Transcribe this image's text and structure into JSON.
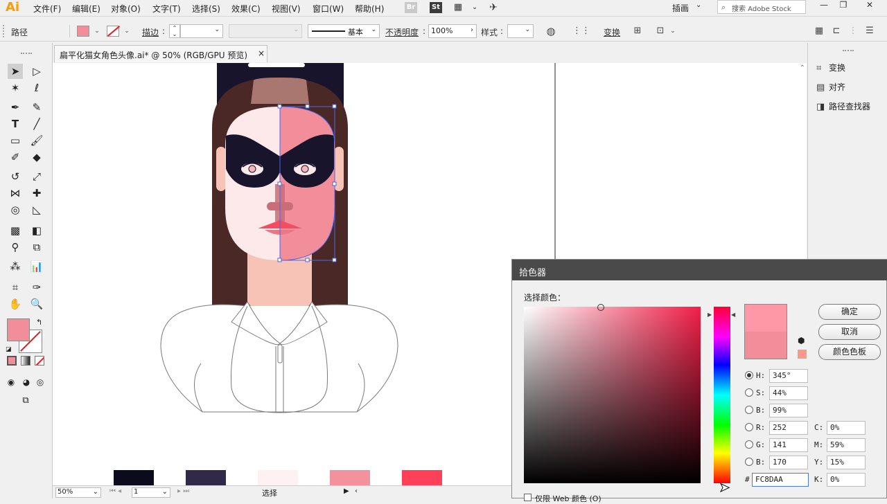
{
  "app": {
    "logo": "Ai"
  },
  "menu": [
    "文件(F)",
    "编辑(E)",
    "对象(O)",
    "文字(T)",
    "选择(S)",
    "效果(C)",
    "视图(V)",
    "窗口(W)",
    "帮助(H)"
  ],
  "menubar_right": {
    "br": "Br",
    "st": "St",
    "workspace": "插画",
    "search_placeholder": "搜索 Adobe Stock"
  },
  "control": {
    "object_type": "路径",
    "stroke_label": "描边",
    "stroke_style": "基本",
    "opacity_label": "不透明度",
    "opacity_value": "100%",
    "style_label": "样式",
    "transform_label": "变换"
  },
  "document": {
    "tab_title": "扁平化猫女角色头像.ai* @ 50% (RGB/GPU 预览)",
    "close": "×"
  },
  "right_panel": {
    "items": [
      "变换",
      "对齐",
      "路径查找器"
    ]
  },
  "status": {
    "zoom": "50%",
    "artboard": "1",
    "mode": "选择"
  },
  "swatches": [
    "#0c0a1d",
    "#302a48",
    "#fff0f1",
    "#f3919d",
    "#fe4158"
  ],
  "colors": {
    "accent": "#f28d9a",
    "mask": "#17142c",
    "hair": "#4a2825",
    "skin": "#fde9ea",
    "neck": "#f7c3b6",
    "lips": "#f44d62",
    "selection": "#4a67e8"
  },
  "picker": {
    "title": "拾色器",
    "prompt": "选择颜色：",
    "ok": "确定",
    "cancel": "取消",
    "swatches_button": "颜色色板",
    "fields": {
      "H": "345°",
      "S": "44%",
      "B": "99%",
      "R": "252",
      "G": "141",
      "B2": "170",
      "C": "0%",
      "M": "59%",
      "Y": "15%",
      "K": "0%",
      "hex": "FC8DAA"
    },
    "web_only": "仅限 Web 颜色 (O)",
    "new_color": "#fd99a7",
    "current_color": "#f28d9a"
  }
}
